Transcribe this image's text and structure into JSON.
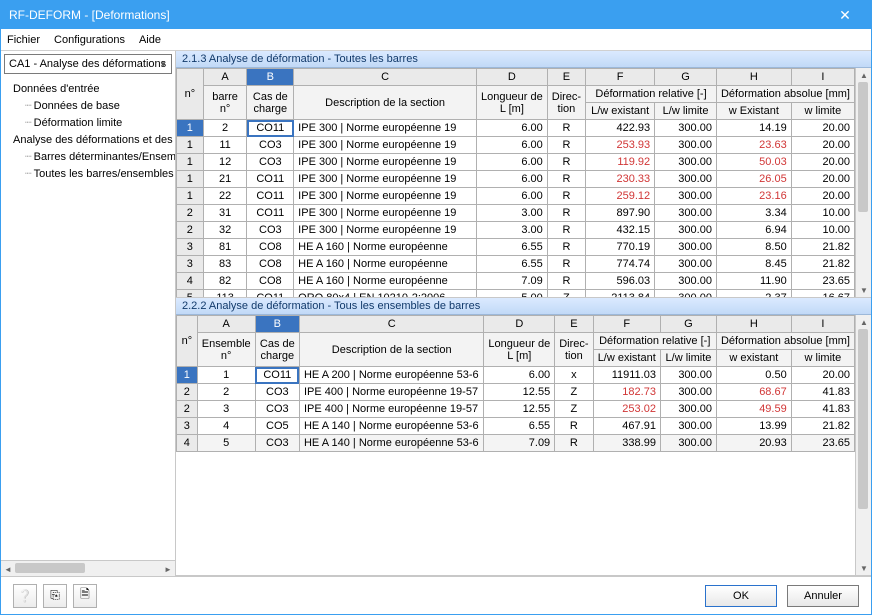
{
  "window": {
    "title": "RF-DEFORM - [Deformations]"
  },
  "menu": {
    "file": "Fichier",
    "config": "Configurations",
    "help": "Aide"
  },
  "combo": {
    "value": "CA1 - Analyse des déformations"
  },
  "tree": {
    "group1": "Données d'entrée",
    "g1a": "Données de base",
    "g1b": "Déformation limite",
    "group2": "Analyse des déformations et des fl",
    "g2a": "Barres déterminantes/Ensemble",
    "g2b": "Toutes les barres/ensembles de"
  },
  "sec1_title": "2.1.3 Analyse de déformation - Toutes les barres",
  "sec2_title": "2.2.2 Analyse de déformation - Tous les ensembles de barres",
  "letters": [
    "A",
    "B",
    "C",
    "D",
    "E",
    "F",
    "G",
    "H",
    "I"
  ],
  "hdr": {
    "no": "n°",
    "barre_no": "barre\nn°",
    "ensemble_no": "Ensemble\nn°",
    "cas": "Cas de\ncharge",
    "desc": "Description de la section",
    "len": "Longueur de\nL [m]",
    "dir": "Direc-\ntion",
    "defrel": "Déformation relative [-]",
    "defabs": "Déformation absolue [mm]",
    "lw_ex": "L/w existant",
    "lw_lim": "L/w limite",
    "w_ex": "w Existant",
    "w_ex2": "w existant",
    "w_lim": "w limite"
  },
  "rows1": [
    {
      "n": "1",
      "a": "2",
      "b": "CO11",
      "c": "IPE 300 | Norme européenne 19",
      "d": "6.00",
      "e": "R",
      "f": "422.93",
      "g": "300.00",
      "h": "14.19",
      "i": "20.00",
      "sel": true
    },
    {
      "n": "1",
      "a": "11",
      "b": "CO3",
      "c": "IPE 300 | Norme européenne 19",
      "d": "6.00",
      "e": "R",
      "f": "253.93",
      "g": "300.00",
      "h": "23.63",
      "i": "20.00",
      "fred": true,
      "hred": true
    },
    {
      "n": "1",
      "a": "12",
      "b": "CO3",
      "c": "IPE 300 | Norme européenne 19",
      "d": "6.00",
      "e": "R",
      "f": "119.92",
      "g": "300.00",
      "h": "50.03",
      "i": "20.00",
      "fred": true,
      "hred": true
    },
    {
      "n": "1",
      "a": "21",
      "b": "CO11",
      "c": "IPE 300 | Norme européenne 19",
      "d": "6.00",
      "e": "R",
      "f": "230.33",
      "g": "300.00",
      "h": "26.05",
      "i": "20.00",
      "fred": true,
      "hred": true
    },
    {
      "n": "1",
      "a": "22",
      "b": "CO11",
      "c": "IPE 300 | Norme européenne 19",
      "d": "6.00",
      "e": "R",
      "f": "259.12",
      "g": "300.00",
      "h": "23.16",
      "i": "20.00",
      "fred": true,
      "hred": true
    },
    {
      "n": "2",
      "a": "31",
      "b": "CO11",
      "c": "IPE 300 | Norme européenne 19",
      "d": "3.00",
      "e": "R",
      "f": "897.90",
      "g": "300.00",
      "h": "3.34",
      "i": "10.00"
    },
    {
      "n": "2",
      "a": "32",
      "b": "CO3",
      "c": "IPE 300 | Norme européenne 19",
      "d": "3.00",
      "e": "R",
      "f": "432.15",
      "g": "300.00",
      "h": "6.94",
      "i": "10.00"
    },
    {
      "n": "3",
      "a": "81",
      "b": "CO8",
      "c": "HE A 160 | Norme européenne",
      "d": "6.55",
      "e": "R",
      "f": "770.19",
      "g": "300.00",
      "h": "8.50",
      "i": "21.82"
    },
    {
      "n": "3",
      "a": "83",
      "b": "CO8",
      "c": "HE A 160 | Norme européenne",
      "d": "6.55",
      "e": "R",
      "f": "774.74",
      "g": "300.00",
      "h": "8.45",
      "i": "21.82"
    },
    {
      "n": "4",
      "a": "82",
      "b": "CO8",
      "c": "HE A 160 | Norme européenne",
      "d": "7.09",
      "e": "R",
      "f": "596.03",
      "g": "300.00",
      "h": "11.90",
      "i": "23.65"
    },
    {
      "n": "5",
      "a": "113",
      "b": "CO11",
      "c": "QRO 80x4 | EN 10210-2:2006",
      "d": "5.00",
      "e": "Z",
      "f": "2113.84",
      "g": "300.00",
      "h": "2.37",
      "i": "16.67"
    }
  ],
  "rows2": [
    {
      "n": "1",
      "a": "1",
      "b": "CO11",
      "c": "HE A 200 | Norme européenne 53-6",
      "d": "6.00",
      "e": "x",
      "f": "11911.03",
      "g": "300.00",
      "h": "0.50",
      "i": "20.00",
      "sel": true
    },
    {
      "n": "2",
      "a": "2",
      "b": "CO3",
      "c": "IPE 400 | Norme européenne 19-57",
      "d": "12.55",
      "e": "Z",
      "f": "182.73",
      "g": "300.00",
      "h": "68.67",
      "i": "41.83",
      "fred": true,
      "hred": true
    },
    {
      "n": "2",
      "a": "3",
      "b": "CO3",
      "c": "IPE 400 | Norme européenne 19-57",
      "d": "12.55",
      "e": "Z",
      "f": "253.02",
      "g": "300.00",
      "h": "49.59",
      "i": "41.83",
      "fred": true,
      "hred": true
    },
    {
      "n": "3",
      "a": "4",
      "b": "CO5",
      "c": "HE A 140 | Norme européenne 53-6",
      "d": "6.55",
      "e": "R",
      "f": "467.91",
      "g": "300.00",
      "h": "13.99",
      "i": "21.82"
    },
    {
      "n": "4",
      "a": "5",
      "b": "CO3",
      "c": "HE A 140 | Norme européenne 53-6",
      "d": "7.09",
      "e": "R",
      "f": "338.99",
      "g": "300.00",
      "h": "20.93",
      "i": "23.65",
      "ghost": true
    }
  ],
  "buttons": {
    "ok": "OK",
    "cancel": "Annuler"
  }
}
